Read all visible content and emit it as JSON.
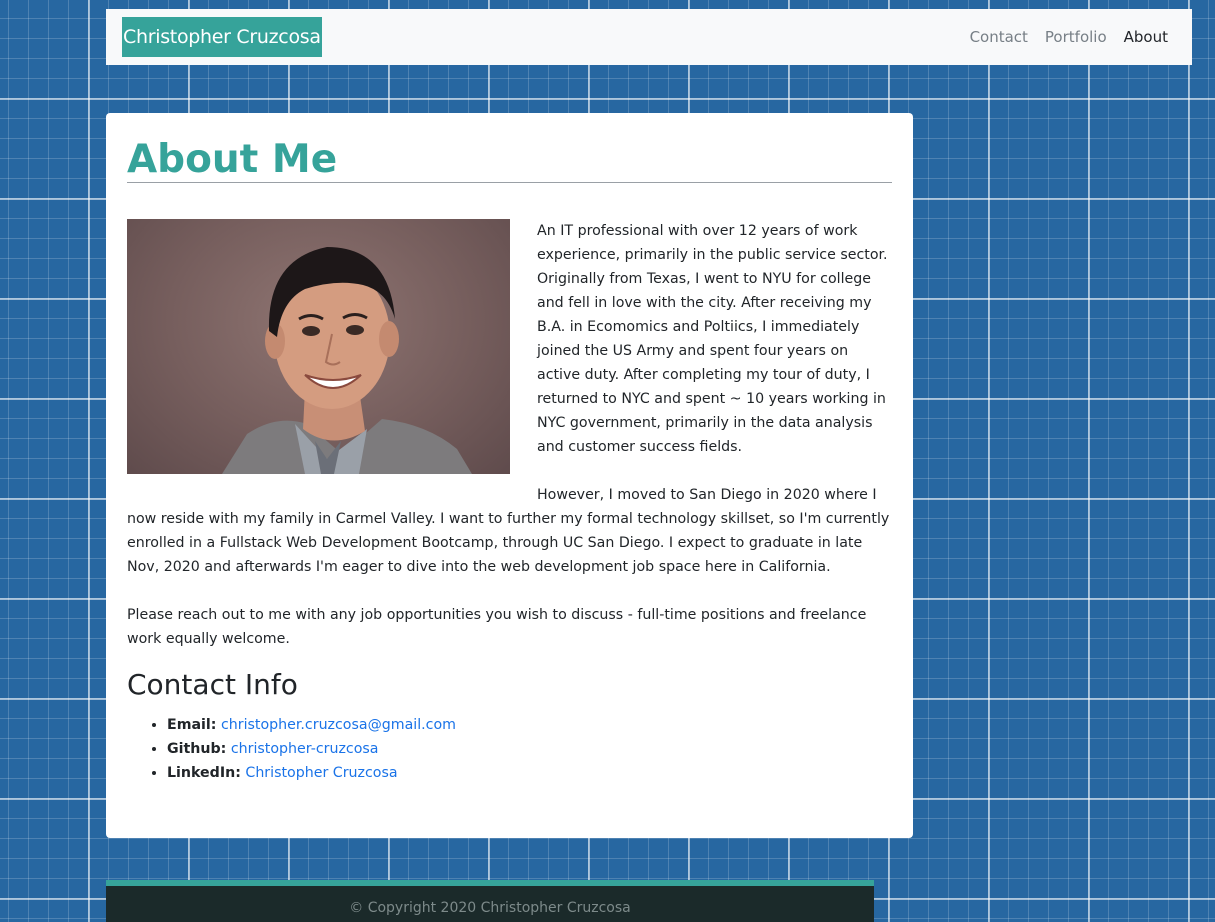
{
  "navbar": {
    "brand": "Christopher Cruzcosa",
    "links": [
      {
        "label": "Contact",
        "active": false
      },
      {
        "label": "Portfolio",
        "active": false
      },
      {
        "label": "About",
        "active": true
      }
    ]
  },
  "about": {
    "title": "About Me",
    "paragraphs": [
      "An IT professional with over 12 years of work experience, primarily in the public service sector. Originally from Texas, I went to NYU for college and fell in love with the city. After receiving my B.A. in Ecomomics and Poltiics, I immediately joined the US Army and spent four years on active duty. After completing my tour of duty, I returned to NYC and spent ~ 10 years working in NYC government, primarily in the data analysis and customer success fields.",
      "However, I moved to San Diego in 2020 where I now reside with my family in Carmel Valley. I want to further my formal technology skillset, so I'm currently enrolled in a Fullstack Web Development Bootcamp, through UC San Diego. I expect to graduate in late Nov, 2020 and afterwards I'm eager to dive into the web development job space here in California.",
      "Please reach out to me with any job opportunities you wish to discuss - full-time positions and freelance work equally welcome."
    ]
  },
  "contact": {
    "title": "Contact Info",
    "items": [
      {
        "label": "Email:",
        "value": "christopher.cruzcosa@gmail.com"
      },
      {
        "label": "Github:",
        "value": "christopher-cruzcosa"
      },
      {
        "label": "LinkedIn:",
        "value": "Christopher Cruzcosa"
      }
    ]
  },
  "footer": {
    "copyright": "© Copyright 2020 Christopher Cruzcosa"
  },
  "colors": {
    "accent": "#36a39a",
    "background": "#2767a1",
    "link": "#1a73e8",
    "footer": "#1b2a2a"
  }
}
